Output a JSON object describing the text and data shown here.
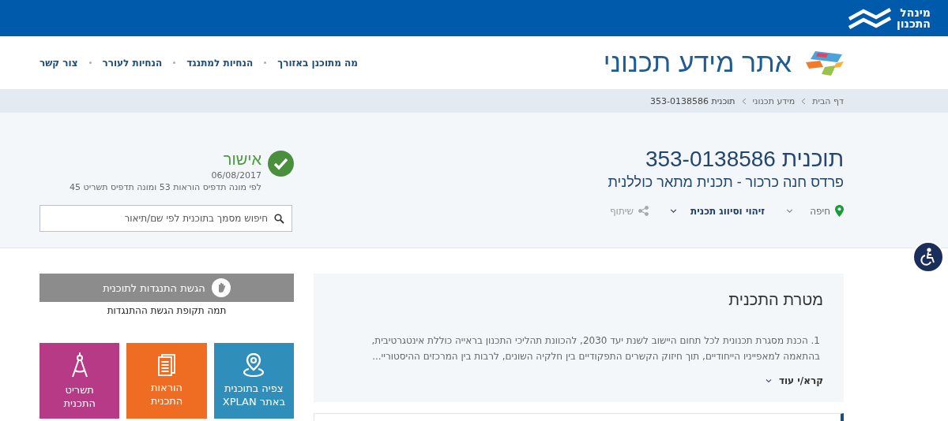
{
  "top_bar": {
    "logo_lines": [
      "מינהל",
      "התכנון"
    ]
  },
  "header": {
    "site_title": "אתר מידע תכנוני",
    "nav": [
      {
        "label": "מה מתוכנן באזורך"
      },
      {
        "label": "הנחיות למתנגד"
      },
      {
        "label": "הנחיות לעורר"
      },
      {
        "label": "צור קשר"
      }
    ]
  },
  "breadcrumb": [
    {
      "label": "דף הבית",
      "current": false
    },
    {
      "label": "מידע תכנוני",
      "current": false
    },
    {
      "label": "תוכנית 353-0138586",
      "current": true
    }
  ],
  "plan": {
    "title": "תוכנית 353-0138586",
    "subtitle": "פרדס חנה כרכור - תכנית מתאר כוללנית",
    "actions": [
      {
        "kind": "location",
        "label": "חיפה"
      },
      {
        "kind": "dropdown",
        "label": "זיהוי וסיווג תכנית"
      },
      {
        "kind": "share",
        "label": "שיתוף"
      }
    ]
  },
  "status": {
    "label": "אישור",
    "approved": true,
    "date": "06/08/2017",
    "note": "לפי מונה תדפיס הוראות 53 ומונה תדפיס תשריט 45"
  },
  "search": {
    "placeholder": "חיפוש מסמך בתוכנית לפי שם/תיאור"
  },
  "objection": {
    "button": "הגשת התנגדות לתוכנית",
    "disabled": true,
    "note": "תמה תקופת הגשת ההתנגדות"
  },
  "tiles": [
    {
      "kind": "map",
      "label": "צפיה בתוכנית\nבאתר XPLAN",
      "color": "#2f8fba"
    },
    {
      "kind": "document",
      "label": "הוראות\nהתכנית",
      "color": "#ef6d22"
    },
    {
      "kind": "compass",
      "label": "תשריט\nהתכנית",
      "color": "#b63a86"
    }
  ],
  "goal": {
    "title": "מטרת התכנית",
    "text": "1. הכנת מסגרת תכנונית לכל תחום היישוב לשנת יעד 2030, להכוונת תהליכי התכנון בראייה כוללת אינטגרטיבית,\nבהתאמה למאפייניו הייחודיים, תוך חיזוק הקשרים התפקודיים בין חלקיה השונים, לרבות בין המרכזים ההיסטוריי...",
    "read_more": "קרא/י עוד"
  }
}
